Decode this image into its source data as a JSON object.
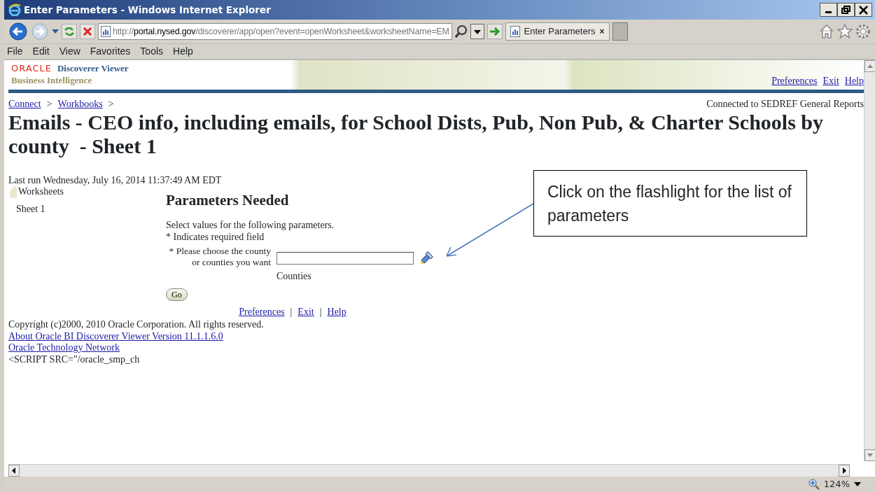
{
  "window": {
    "title": "Enter Parameters - Windows Internet Explorer"
  },
  "address_bar": {
    "scheme": "http://",
    "domain": "portal.nysed.gov",
    "path": "/discoverer/app/open?event=openWorksheet&worksheetName=EM"
  },
  "tabs": [
    {
      "label": "Enter Parameters",
      "selected": true,
      "close": "×"
    }
  ],
  "menu": [
    {
      "label": "File"
    },
    {
      "label": "Edit"
    },
    {
      "label": "View"
    },
    {
      "label": "Favorites"
    },
    {
      "label": "Tools"
    },
    {
      "label": "Help"
    }
  ],
  "header": {
    "brand": "ORACLE",
    "product": "Discoverer Viewer",
    "subtitle": "Business Intelligence",
    "links": [
      "Preferences",
      "Exit",
      "Help"
    ]
  },
  "breadcrumb": [
    {
      "label": "Connect",
      "separator": ">"
    },
    {
      "label": "Workbooks",
      "separator": ">"
    }
  ],
  "connection": "Connected to SEDREF General Reports",
  "page_title": "Emails - CEO info, including emails, for School Dists, Pub, Non Pub, & Charter Schools by county  - Sheet 1",
  "last_run": "Last run Wednesday, July 16, 2014 11:37:49 AM EDT",
  "sidebar": {
    "heading": "Worksheets",
    "items": [
      {
        "label": "Sheet 1"
      }
    ]
  },
  "parameters": {
    "heading": "Parameters Needed",
    "instructions": [
      "Select values for the following parameters.",
      "* Indicates required field"
    ],
    "fields": [
      {
        "label": "* Please choose the county or counties you want",
        "hint": "Counties"
      }
    ],
    "submit": "Go"
  },
  "footer": {
    "links": [
      {
        "label": "Preferences"
      },
      {
        "label": "Exit",
        "separator": "|"
      },
      {
        "label": "Help",
        "separator": "|"
      }
    ],
    "copyright": "Copyright (c)2000, 2010 Oracle Corporation. All rights reserved.",
    "about_link": "About Oracle BI Discoverer Viewer Version 11.1.1.6.0",
    "otn_link": "Oracle Technology Network",
    "raw_text": "<SCRIPT SRC=\"/oracle_smp_ch"
  },
  "callout": {
    "text": "Click on the flashlight for the list of parameters"
  },
  "status_bar": {
    "zoom": "124%"
  }
}
